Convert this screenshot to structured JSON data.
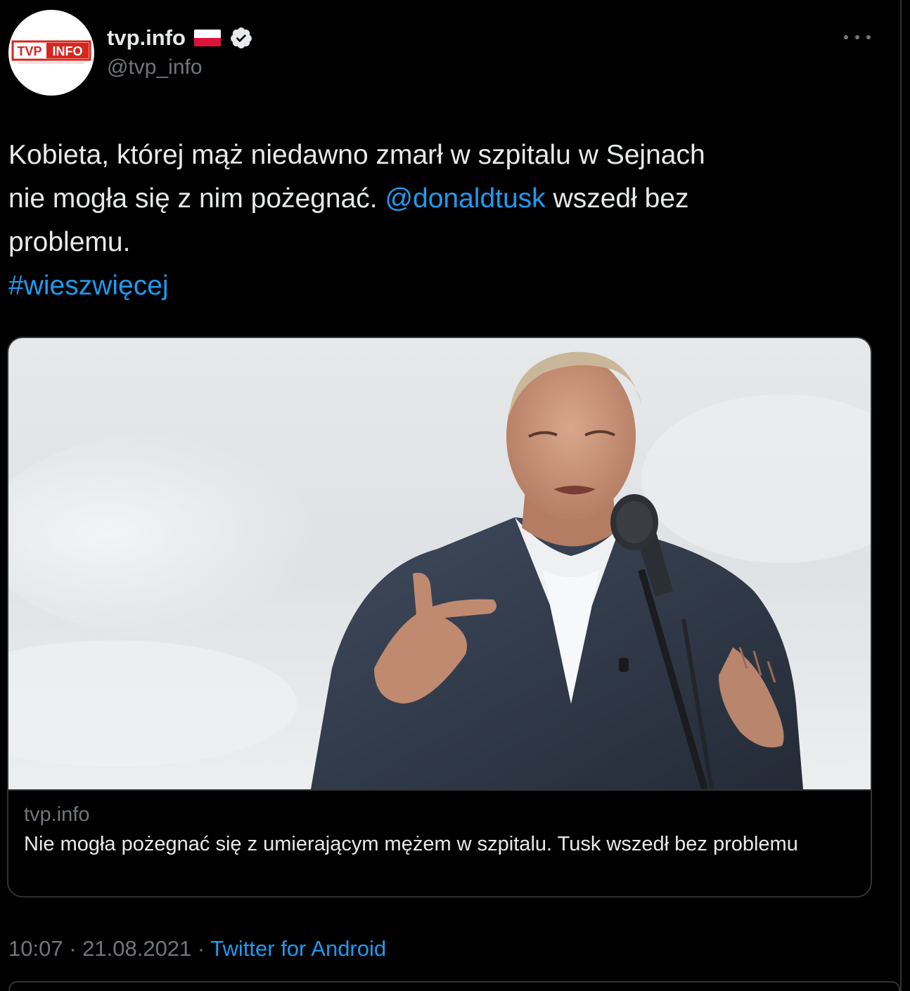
{
  "author": {
    "display_name": "tvp.info",
    "handle": "@tvp_info",
    "avatar_logo_left": "TVP",
    "avatar_logo_right": "INFO",
    "flag_icon": "poland-flag-icon",
    "verified_icon": "verified-badge-icon"
  },
  "more_icon": "more-horizontal-icon",
  "tweet": {
    "text_line1": "Kobieta, której mąż niedawno zmarł w szpitalu w Sejnach",
    "text_line2_pre": "nie mogła się z nim pożegnać. ",
    "mention": "@donaldtusk",
    "text_line2_post": " wszedł bez",
    "text_line3": "problemu.",
    "hashtag": "#wieszwięcej"
  },
  "card": {
    "image_icon": "photo-man-speaking-at-microphone",
    "domain": "tvp.info",
    "title": "Nie mogła pożegnać się z umierającym mężem w szpitalu. Tusk wszedł bez problemu"
  },
  "meta": {
    "time": "10:07",
    "separator1": " · ",
    "date": "21.08.2021",
    "separator2": " · ",
    "source": "Twitter for Android"
  },
  "colors": {
    "background": "#000000",
    "text": "#e7e9ea",
    "secondary": "#71767b",
    "link": "#1d9bf0",
    "border": "#2f3336",
    "tvp_red": "#d7261e"
  }
}
